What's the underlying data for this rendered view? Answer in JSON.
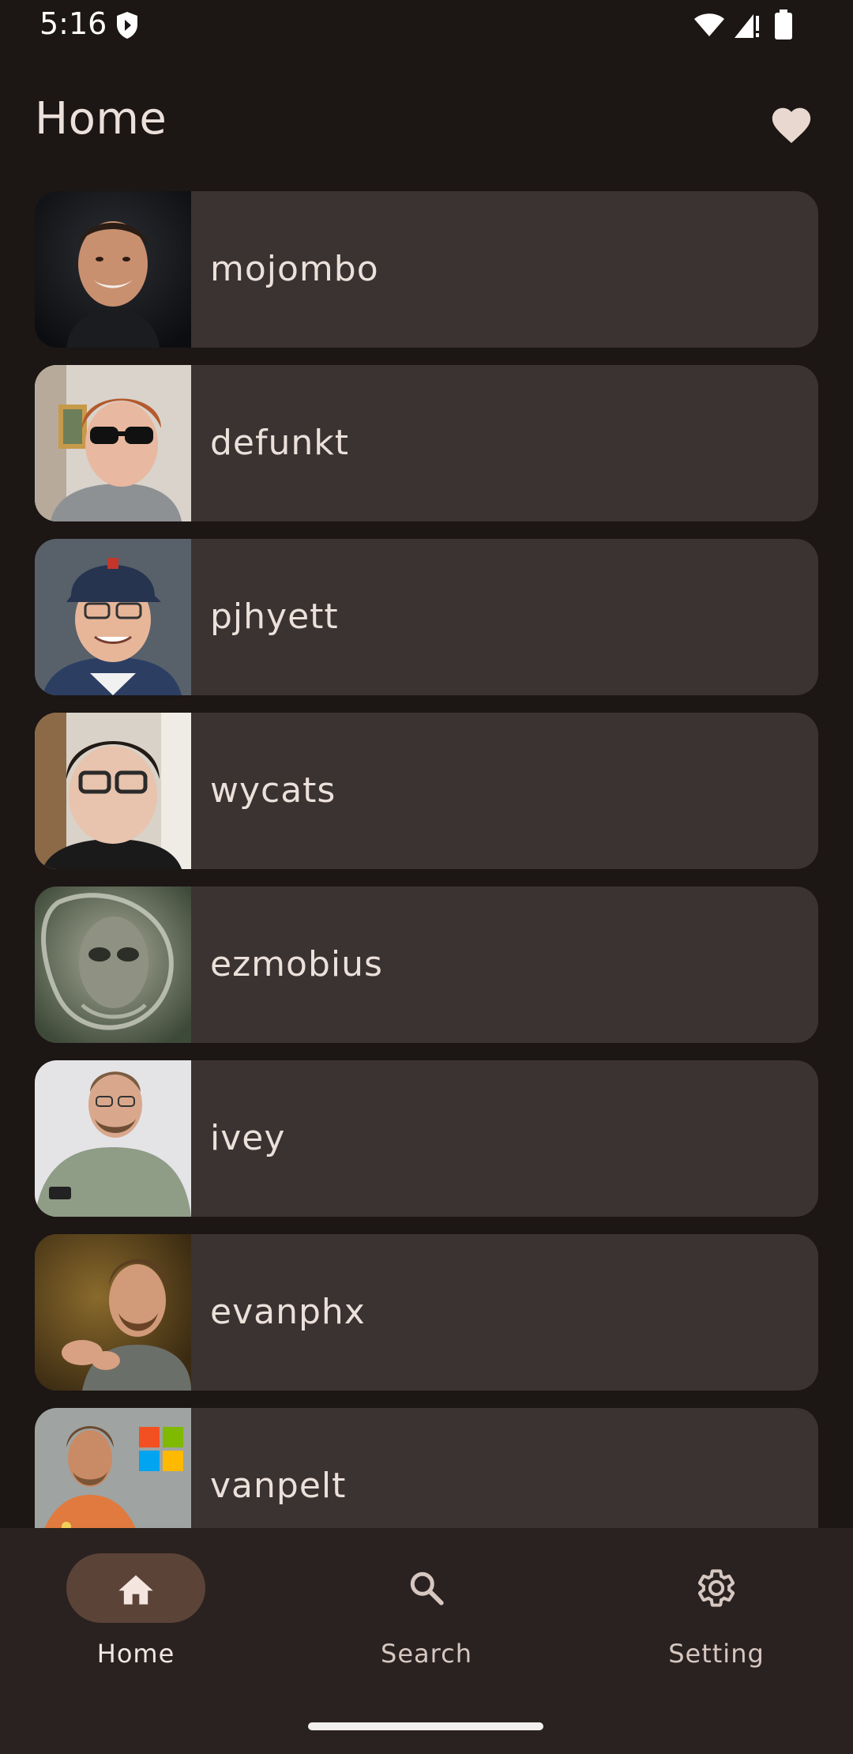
{
  "status_bar": {
    "time": "5:16"
  },
  "app_bar": {
    "title": "Home",
    "favorites_icon": "heart-icon"
  },
  "users": [
    {
      "login": "mojombo",
      "avatar": "person-dark-bg"
    },
    {
      "login": "defunkt",
      "avatar": "person-sunglasses"
    },
    {
      "login": "pjhyett",
      "avatar": "person-cap"
    },
    {
      "login": "wycats",
      "avatar": "person-glasses"
    },
    {
      "login": "ezmobius",
      "avatar": "alien-art"
    },
    {
      "login": "ivey",
      "avatar": "person-phone"
    },
    {
      "login": "evanphx",
      "avatar": "person-gesturing"
    },
    {
      "login": "vanpelt",
      "avatar": "person-windows-logo"
    }
  ],
  "bottom_nav": {
    "items": [
      {
        "label": "Home",
        "icon": "home-icon",
        "active": true
      },
      {
        "label": "Search",
        "icon": "search-icon",
        "active": false
      },
      {
        "label": "Setting",
        "icon": "gear-icon",
        "active": false
      }
    ]
  },
  "colors": {
    "background": "#1c1614",
    "card": "#3b3331",
    "nav_background": "#2a2220",
    "nav_active_pill": "#5b4338",
    "text": "#ece0db",
    "heart": "#e9d8d0"
  }
}
